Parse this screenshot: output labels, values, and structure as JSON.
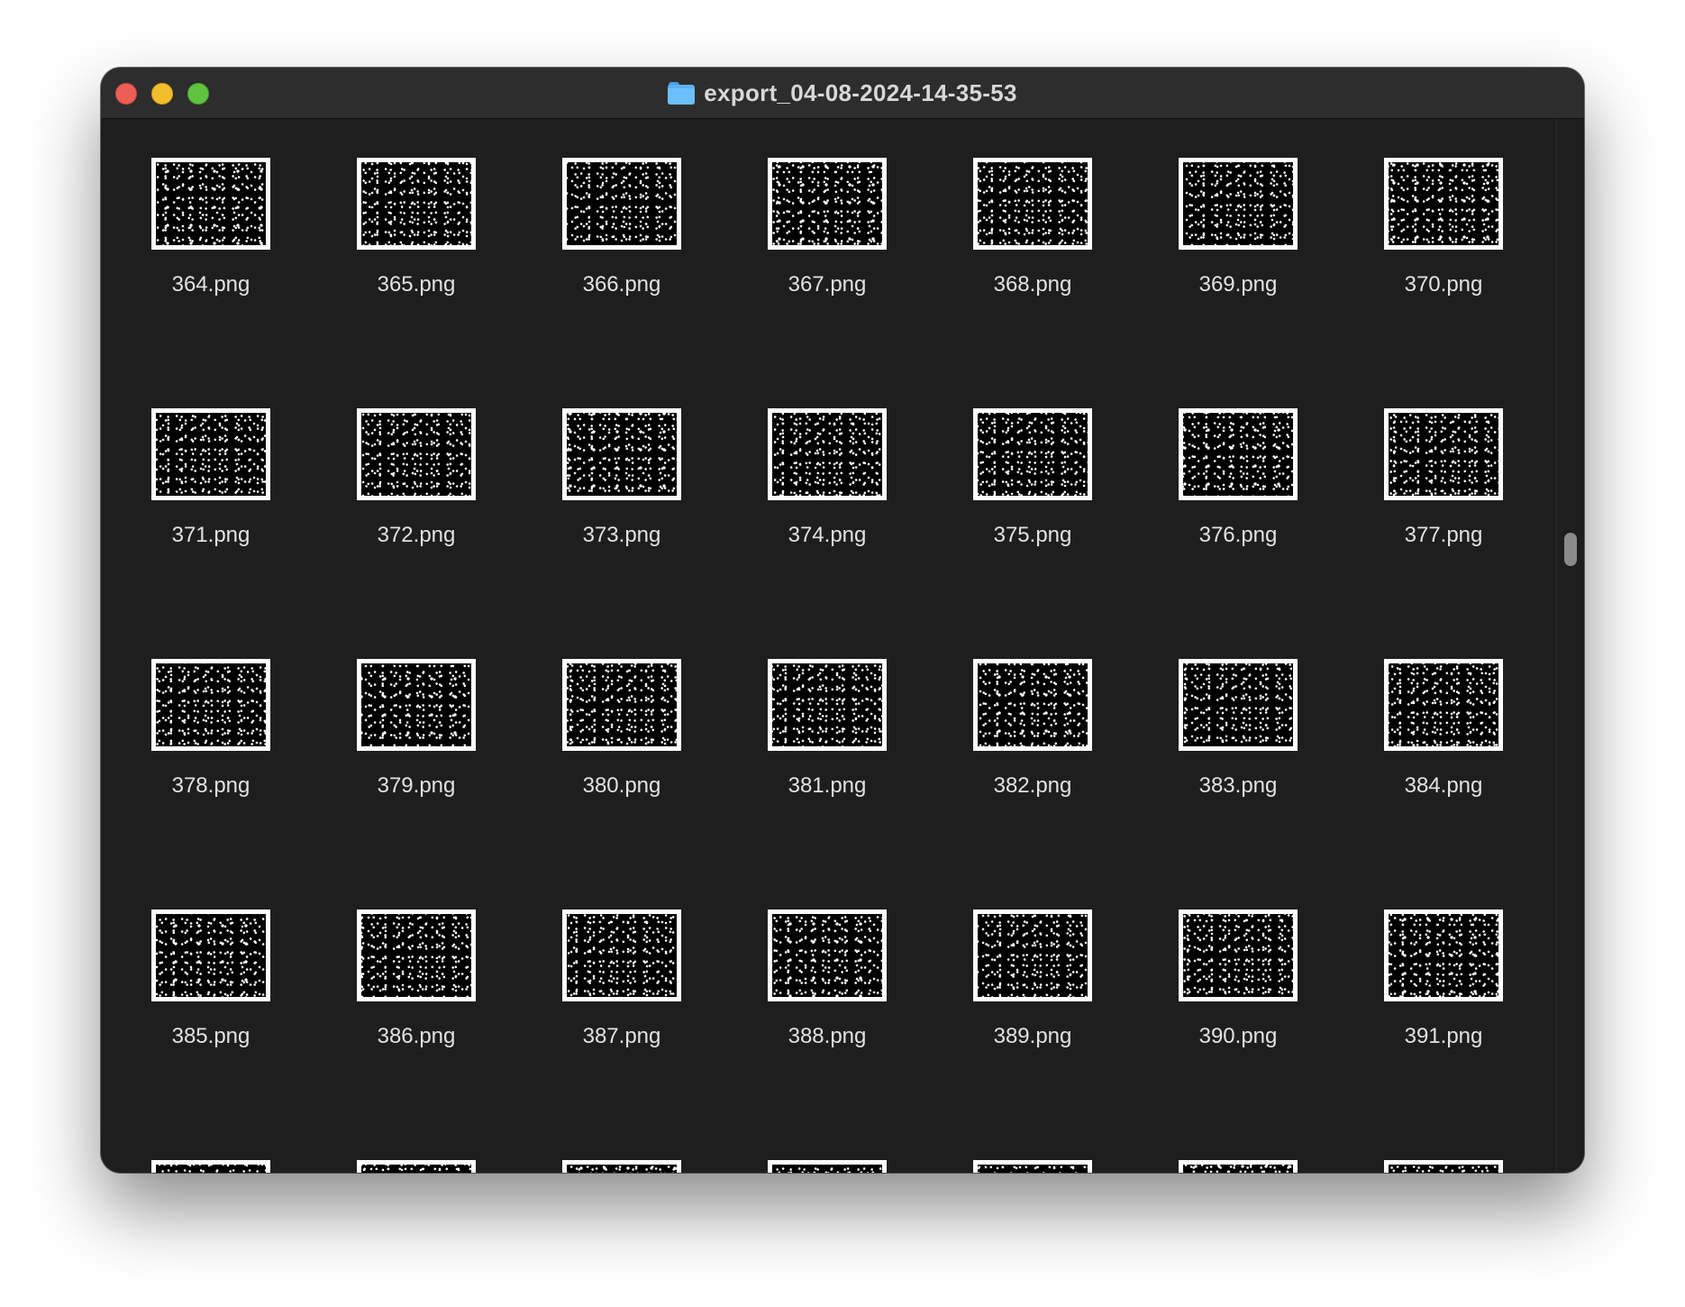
{
  "window": {
    "title": "export_04-08-2024-14-35-53",
    "title_icon": "folder-icon"
  },
  "traffic_lights": {
    "close_color": "#ec5f57",
    "minimize_color": "#f2bd2d",
    "zoom_color": "#5fc340"
  },
  "files": [
    {
      "name": "364.png"
    },
    {
      "name": "365.png"
    },
    {
      "name": "366.png"
    },
    {
      "name": "367.png"
    },
    {
      "name": "368.png"
    },
    {
      "name": "369.png"
    },
    {
      "name": "370.png"
    },
    {
      "name": "371.png"
    },
    {
      "name": "372.png"
    },
    {
      "name": "373.png"
    },
    {
      "name": "374.png"
    },
    {
      "name": "375.png"
    },
    {
      "name": "376.png"
    },
    {
      "name": "377.png"
    },
    {
      "name": "378.png"
    },
    {
      "name": "379.png"
    },
    {
      "name": "380.png"
    },
    {
      "name": "381.png"
    },
    {
      "name": "382.png"
    },
    {
      "name": "383.png"
    },
    {
      "name": "384.png"
    },
    {
      "name": "385.png"
    },
    {
      "name": "386.png"
    },
    {
      "name": "387.png"
    },
    {
      "name": "388.png"
    },
    {
      "name": "389.png"
    },
    {
      "name": "390.png"
    },
    {
      "name": "391.png"
    },
    {
      "name": ""
    },
    {
      "name": ""
    },
    {
      "name": ""
    },
    {
      "name": ""
    },
    {
      "name": ""
    },
    {
      "name": ""
    },
    {
      "name": ""
    }
  ],
  "scrollbar": {
    "position_fraction": 0.39
  }
}
